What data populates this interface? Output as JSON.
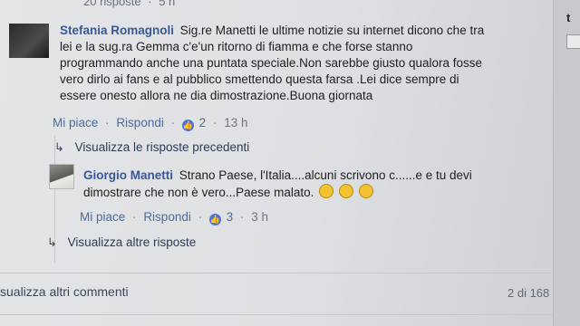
{
  "top": {
    "replies": "20 risposte",
    "dot": "·",
    "time": "5 h"
  },
  "comment1": {
    "author": "Stefania Romagnoli",
    "text": "Sig.re Manetti le ultime notizie su internet dicono che tra lei e la sug.ra Gemma c'e'un ritorno di fiamma e che forse stanno programmando anche una puntata speciale.Non sarebbe giusto qualora fosse vero dirlo ai fans e al pubblico smettendo questa farsa .Lei dice sempre di essere onesto allora ne dia dimostrazione.Buona giornata",
    "like": "Mi piace",
    "reply": "Rispondi",
    "likes": "2",
    "time": "13 h"
  },
  "view_previous": "Visualizza le risposte precedenti",
  "comment2": {
    "author": "Giorgio Manetti",
    "text": "Strano Paese, l'Italia....alcuni scrivono c......e e tu devi dimostrare che non è vero...Paese malato.",
    "like": "Mi piace",
    "reply": "Rispondi",
    "likes": "3",
    "time": "3 h"
  },
  "view_more": "Visualizza altre risposte",
  "footer": {
    "view_comments": "sualizza altri commenti",
    "pager": "2 di 168"
  },
  "rightbar": {
    "text": "t"
  },
  "icons": [
    "reply-arrow-icon",
    "like-icon",
    "laugh-emoji-icon"
  ],
  "colors": {
    "link": "#365899",
    "background": "#e4e5e7"
  }
}
